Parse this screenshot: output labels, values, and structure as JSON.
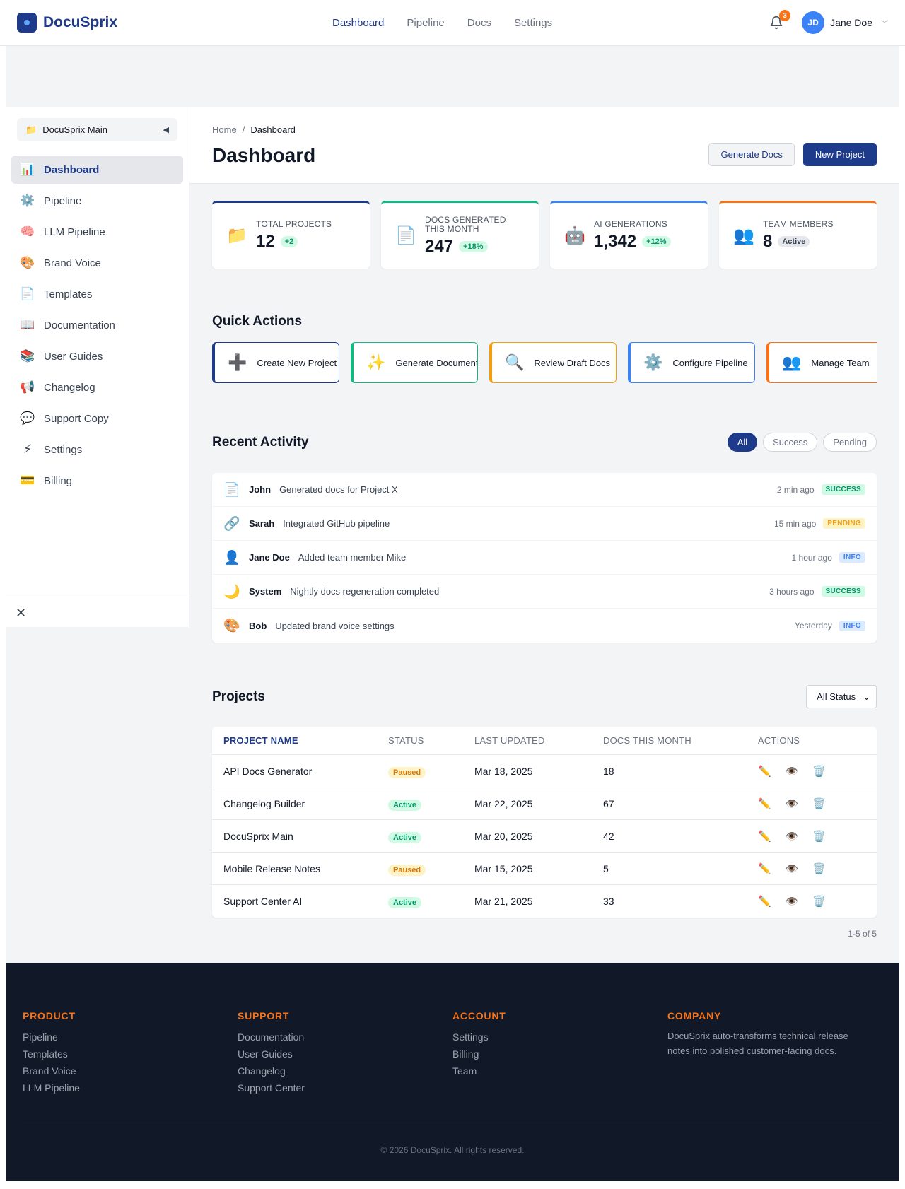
{
  "app": {
    "name": "DocuSprix"
  },
  "topnav": [
    {
      "label": "Dashboard",
      "active": true
    },
    {
      "label": "Pipeline"
    },
    {
      "label": "Docs"
    },
    {
      "label": "Settings"
    }
  ],
  "notifications": {
    "count": "3"
  },
  "user": {
    "initials": "JD",
    "name": "Jane Doe"
  },
  "workspace": {
    "name": "DocuSprix Main"
  },
  "sidebar": {
    "items": [
      {
        "label": "Dashboard",
        "icon": "📊",
        "icon_name": "chart-icon",
        "active": true
      },
      {
        "label": "Pipeline",
        "icon": "⚙️",
        "icon_name": "gear-icon"
      },
      {
        "label": "LLM Pipeline",
        "icon": "🧠",
        "icon_name": "brain-icon"
      },
      {
        "label": "Brand Voice",
        "icon": "🎨",
        "icon_name": "palette-icon"
      },
      {
        "label": "Templates",
        "icon": "📄",
        "icon_name": "document-icon"
      },
      {
        "label": "Documentation",
        "icon": "📖",
        "icon_name": "book-icon"
      },
      {
        "label": "User Guides",
        "icon": "📚",
        "icon_name": "books-icon"
      },
      {
        "label": "Changelog",
        "icon": "📢",
        "icon_name": "megaphone-icon"
      },
      {
        "label": "Support Copy",
        "icon": "💬",
        "icon_name": "speech-bubble-icon"
      },
      {
        "label": "Settings",
        "icon": "⚡",
        "icon_name": "lightning-icon"
      },
      {
        "label": "Billing",
        "icon": "💳",
        "icon_name": "credit-card-icon"
      }
    ]
  },
  "breadcrumb": {
    "home": "Home",
    "sep": "/",
    "current": "Dashboard"
  },
  "page": {
    "title": "Dashboard",
    "generate_label": "Generate Docs",
    "new_label": "New Project"
  },
  "stats": [
    {
      "label": "Total Projects",
      "value": "12",
      "badge": "+2",
      "icon": "📁",
      "icon_name": "folder-icon",
      "color": "#1e3a8a",
      "badge_style": "green"
    },
    {
      "label": "Docs Generated This Month",
      "value": "247",
      "badge": "+18%",
      "icon": "📄",
      "icon_name": "document-icon",
      "color": "#10b981",
      "badge_style": "green"
    },
    {
      "label": "AI Generations",
      "value": "1,342",
      "badge": "+12%",
      "icon": "🤖",
      "icon_name": "robot-icon",
      "color": "#3b82f6",
      "badge_style": "green"
    },
    {
      "label": "Team Members",
      "value": "8",
      "badge": "Active",
      "icon": "👥",
      "icon_name": "people-icon",
      "color": "#f97316",
      "badge_style": "gray"
    }
  ],
  "quick_actions": {
    "title": "Quick Actions",
    "items": [
      {
        "label": "Create New Project",
        "icon": "➕",
        "icon_name": "plus-icon",
        "color": "#1e3a8a"
      },
      {
        "label": "Generate Documentation",
        "icon": "✨",
        "icon_name": "sparkles-icon",
        "color": "#10b981"
      },
      {
        "label": "Review Draft Docs",
        "icon": "🔍",
        "icon_name": "magnifier-icon",
        "color": "#f59e0b"
      },
      {
        "label": "Configure Pipeline",
        "icon": "⚙️",
        "icon_name": "gear-icon",
        "color": "#3b82f6"
      },
      {
        "label": "Manage Team",
        "icon": "👥",
        "icon_name": "people-icon",
        "color": "#f97316"
      }
    ]
  },
  "activity": {
    "title": "Recent Activity",
    "filters": [
      {
        "label": "All",
        "active": true
      },
      {
        "label": "Success"
      },
      {
        "label": "Pending"
      }
    ],
    "items": [
      {
        "icon": "📄",
        "icon_name": "document-icon",
        "who": "John",
        "what": "Generated docs for Project X",
        "when": "2 min ago",
        "status": "SUCCESS",
        "kind": "success"
      },
      {
        "icon": "🔗",
        "icon_name": "link-icon",
        "who": "Sarah",
        "what": "Integrated GitHub pipeline",
        "when": "15 min ago",
        "status": "PENDING",
        "kind": "pending"
      },
      {
        "icon": "👤",
        "icon_name": "person-icon",
        "who": "Jane Doe",
        "what": "Added team member Mike",
        "when": "1 hour ago",
        "status": "INFO",
        "kind": "info"
      },
      {
        "icon": "🌙",
        "icon_name": "moon-icon",
        "who": "System",
        "what": "Nightly docs regeneration completed",
        "when": "3 hours ago",
        "status": "SUCCESS",
        "kind": "success"
      },
      {
        "icon": "🎨",
        "icon_name": "palette-icon",
        "who": "Bob",
        "what": "Updated brand voice settings",
        "when": "Yesterday",
        "status": "INFO",
        "kind": "info"
      }
    ]
  },
  "projects": {
    "title": "Projects",
    "filter_value": "All Status",
    "columns": [
      "Project Name",
      "Status",
      "Last Updated",
      "Docs This Month",
      "Actions"
    ],
    "rows": [
      {
        "name": "API Docs Generator",
        "status": "Paused",
        "updated": "Mar 18, 2025",
        "docs": "18"
      },
      {
        "name": "Changelog Builder",
        "status": "Active",
        "updated": "Mar 22, 2025",
        "docs": "67"
      },
      {
        "name": "DocuSprix Main",
        "status": "Active",
        "updated": "Mar 20, 2025",
        "docs": "42"
      },
      {
        "name": "Mobile Release Notes",
        "status": "Paused",
        "updated": "Mar 15, 2025",
        "docs": "5"
      },
      {
        "name": "Support Center AI",
        "status": "Active",
        "updated": "Mar 21, 2025",
        "docs": "33"
      }
    ],
    "pagination": "1-5 of 5"
  },
  "footer": {
    "columns": [
      {
        "title": "PRODUCT",
        "links": [
          "Pipeline",
          "Templates",
          "Brand Voice",
          "LLM Pipeline"
        ]
      },
      {
        "title": "SUPPORT",
        "links": [
          "Documentation",
          "User Guides",
          "Changelog",
          "Support Center"
        ]
      },
      {
        "title": "ACCOUNT",
        "links": [
          "Settings",
          "Billing",
          "Team"
        ]
      }
    ],
    "company": {
      "title": "COMPANY",
      "text": "DocuSprix auto-transforms technical release notes into polished customer-facing docs."
    },
    "copyright": "© 2026 DocuSprix. All rights reserved."
  },
  "colors": {
    "primary": "#1e3a8a",
    "accent": "#f97316",
    "success": "#10b981",
    "warning": "#f59e0b",
    "info": "#3b82f6"
  }
}
